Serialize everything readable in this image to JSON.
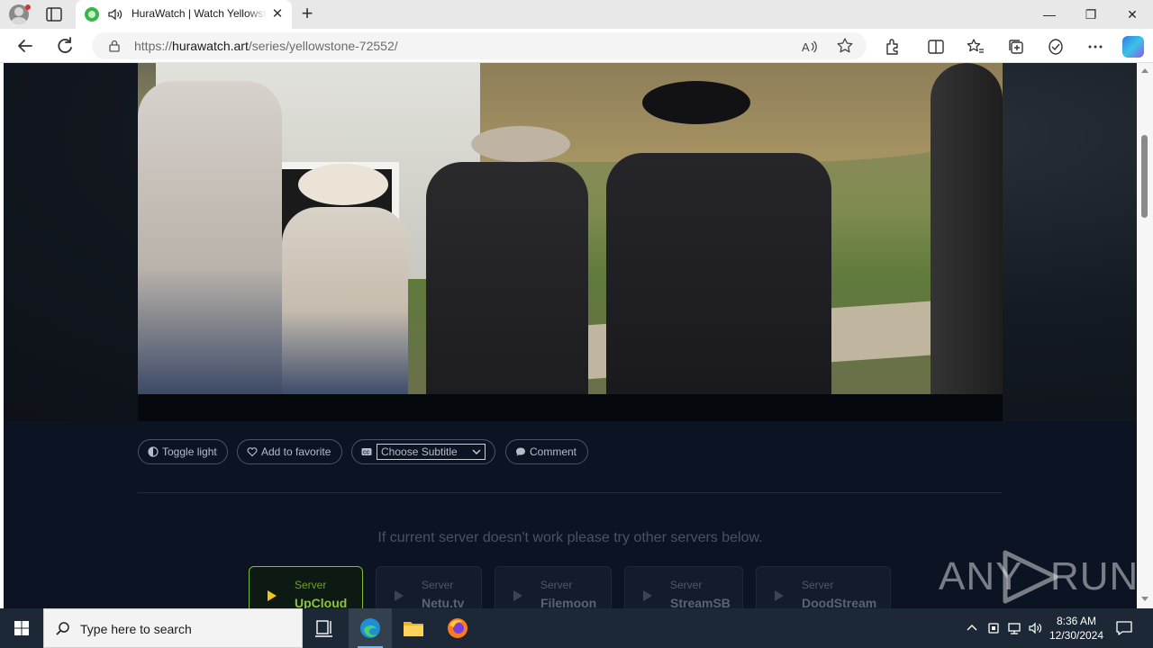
{
  "browser": {
    "tab": {
      "title": "HuraWatch | Watch Yellowstone",
      "close_glyph": "✕"
    },
    "new_tab_glyph": "+",
    "window_controls": {
      "minimize": "—",
      "maximize": "❐",
      "close": "✕"
    },
    "address": {
      "scheme": "https://",
      "host": "hurawatch.art",
      "path": "/series/yellowstone-72552/"
    }
  },
  "player": {
    "buttons": {
      "toggle_light": "Toggle light",
      "add_favorite": "Add to favorite",
      "subtitle_select": "Choose Subtitle",
      "comment": "Comment"
    },
    "notice": "If current server doesn't work please try other servers below.",
    "servers": [
      {
        "label": "Server",
        "name": "UpCloud",
        "active": true
      },
      {
        "label": "Server",
        "name": "Netu.tv",
        "active": false
      },
      {
        "label": "Server",
        "name": "Filemoon",
        "active": false
      },
      {
        "label": "Server",
        "name": "StreamSB",
        "active": false
      },
      {
        "label": "Server",
        "name": "DoodStream",
        "active": false
      }
    ]
  },
  "watermark": {
    "left": "ANY",
    "right": "RUN"
  },
  "taskbar": {
    "search_placeholder": "Type here to search",
    "time": "8:36 AM",
    "date": "12/30/2024"
  },
  "colors": {
    "accent_active": "#8bc53f",
    "page_bg": "#0c1424",
    "taskbar": "#1c2836"
  }
}
